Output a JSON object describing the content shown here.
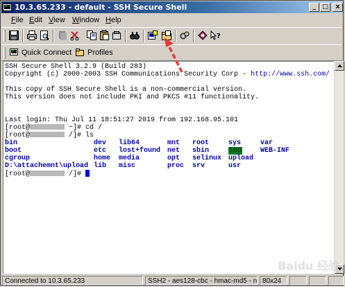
{
  "window": {
    "title": "10.3.65.233 - default - SSH Secure Shell"
  },
  "title_buttons": {
    "minimize": "_",
    "maximize": "□",
    "close": "x"
  },
  "menu": [
    {
      "label": "File",
      "u": "F",
      "rest": "ile"
    },
    {
      "label": "Edit",
      "u": "E",
      "rest": "dit"
    },
    {
      "label": "View",
      "u": "V",
      "rest": "iew"
    },
    {
      "label": "Window",
      "u": "W",
      "rest": "indow"
    },
    {
      "label": "Help",
      "u": "H",
      "rest": "elp"
    }
  ],
  "toolbar_icons": [
    "save-icon",
    "print-icon",
    "print-preview-icon",
    "copy-icon",
    "paste-icon",
    "find-icon",
    "search-icon",
    "new-terminal-window-icon",
    "new-file-transfer-window-icon",
    "settings-icon",
    "profiles-icon",
    "help-context-icon"
  ],
  "quick_bar": {
    "quick_connect": "Quick Connect",
    "profiles": "Profiles"
  },
  "terminal": {
    "l1": "SSH Secure Shell 3.2.9 (Build 283)",
    "l2_a": "Copyright (c) 2000-2003 SSH Communications Security Corp - ",
    "l2_link": "http://www.ssh.com/",
    "l3": "This copy of SSH Secure Shell is a non-commercial version.",
    "l4": "This version does not include PKI and PKCS #11 functionality.",
    "l5": "Last login: Thu Jul 11 18:51:27 2019 from 192.168.95.101",
    "p1_a": "[root@",
    "p1_b": " ~]# cd /",
    "p2_a": "[root@",
    "p2_b": " /]# ls",
    "p3_a": "[root@",
    "p3_b": " /]# ",
    "ls": [
      [
        "bin",
        "dev",
        "lib64",
        "mnt",
        "root",
        "sys",
        "var"
      ],
      [
        "boot",
        "etc",
        "lost+found",
        "net",
        "sbin",
        "tmp",
        "WEB-INF"
      ],
      [
        "cgroup",
        "home",
        "media",
        "opt",
        "selinux",
        "upload",
        ""
      ],
      [
        "D:\\attachemnt\\upload",
        "lib",
        "misc",
        "proc",
        "srv",
        "usr",
        ""
      ]
    ]
  },
  "status": {
    "connection": "Connected to 10.3.65.233",
    "cipher": "SSH2 - aes128-cbc - hmac-md5 - n",
    "size": "80x24"
  },
  "colors": {
    "ls_dir": "#0000aa",
    "tmp_bg": "#0a7a2a",
    "title_start": "#0a246a",
    "arrow": "#e83a3a"
  },
  "watermark": "Baidu 经验"
}
